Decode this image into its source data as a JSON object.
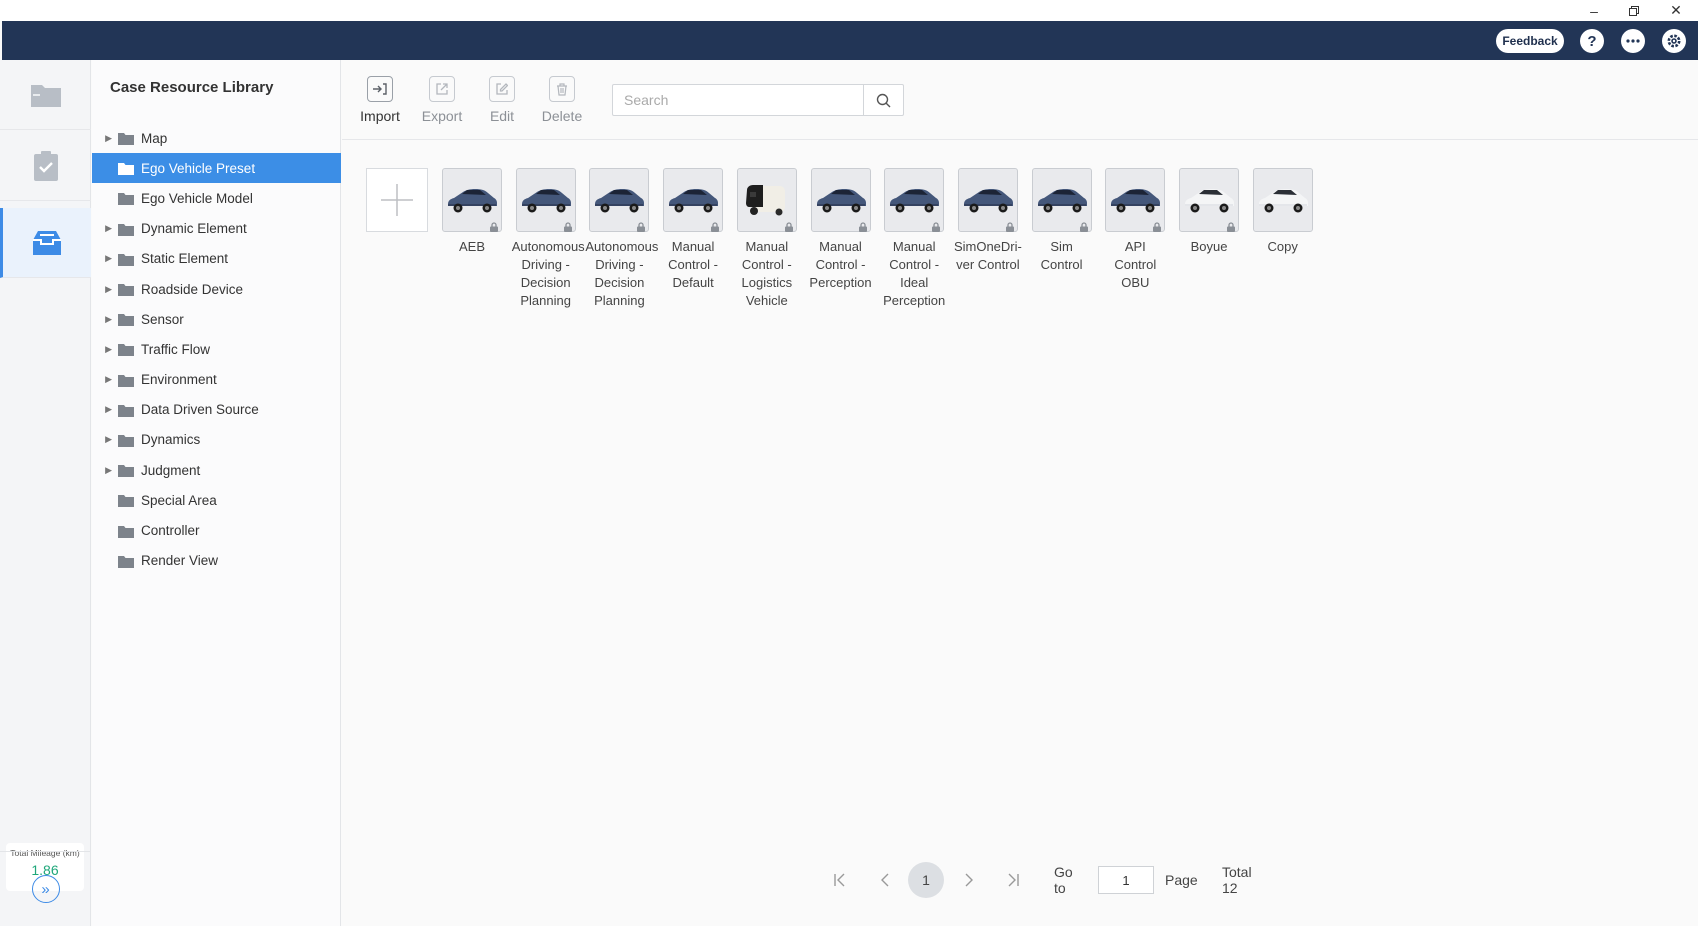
{
  "window": {
    "minimize_icon": "minimize-icon",
    "restore_icon": "restore-icon",
    "close_icon": "close-icon"
  },
  "header": {
    "feedback_label": "Feedback",
    "help_icon": "help-icon",
    "more_icon": "more-icon",
    "settings_icon": "settings-icon",
    "background_color": "#223556"
  },
  "rail": {
    "items": [
      {
        "icon": "folder-icon"
      },
      {
        "icon": "clipboard-check-icon"
      },
      {
        "icon": "tray-icon",
        "active": true
      }
    ],
    "mileage_label": "Total Mileage (km)",
    "mileage_value": "1.86",
    "expand_icon": "double-chevron-right-icon"
  },
  "tree": {
    "title": "Case Resource Library",
    "items": [
      {
        "label": "Map",
        "expandable": true
      },
      {
        "label": "Ego Vehicle Preset",
        "expandable": false,
        "selected": true
      },
      {
        "label": "Ego Vehicle Model",
        "expandable": false
      },
      {
        "label": "Dynamic Element",
        "expandable": true
      },
      {
        "label": "Static Element",
        "expandable": true
      },
      {
        "label": "Roadside Device",
        "expandable": true
      },
      {
        "label": "Sensor",
        "expandable": true
      },
      {
        "label": "Traffic Flow",
        "expandable": true
      },
      {
        "label": "Environment",
        "expandable": true
      },
      {
        "label": "Data Driven Source",
        "expandable": true
      },
      {
        "label": "Dynamics",
        "expandable": true
      },
      {
        "label": "Judgment",
        "expandable": true
      },
      {
        "label": "Special Area",
        "expandable": false
      },
      {
        "label": "Controller",
        "expandable": false
      },
      {
        "label": "Render View",
        "expandable": false
      }
    ],
    "accent_color": "#3c8ee6"
  },
  "toolbar": {
    "import_label": "Import",
    "export_label": "Export",
    "edit_label": "Edit",
    "delete_label": "Delete",
    "search_placeholder": "Search"
  },
  "cards": [
    {
      "lines": [
        "AEB"
      ],
      "thumb": "sedan-blue",
      "locked": true
    },
    {
      "lines": [
        "Autonomous",
        "Driving -",
        "Decision",
        "Planning"
      ],
      "thumb": "sedan-blue",
      "locked": true
    },
    {
      "lines": [
        "Autonomous",
        "Driving -",
        "Decision",
        "Planning"
      ],
      "thumb": "sedan-blue",
      "locked": true
    },
    {
      "lines": [
        "Manual",
        "Control -",
        "Default"
      ],
      "thumb": "sedan-blue",
      "locked": true
    },
    {
      "lines": [
        "Manual",
        "Control -",
        "Logistics",
        "Vehicle"
      ],
      "thumb": "logistics-robot",
      "locked": true
    },
    {
      "lines": [
        "Manual",
        "Control -",
        "Perception"
      ],
      "thumb": "sedan-blue",
      "locked": true
    },
    {
      "lines": [
        "Manual",
        "Control -",
        "Ideal",
        "Perception"
      ],
      "thumb": "sedan-blue",
      "locked": true
    },
    {
      "lines": [
        "SimOneDri-",
        "ver Control"
      ],
      "thumb": "sedan-blue",
      "locked": true
    },
    {
      "lines": [
        "Sim",
        "Control"
      ],
      "thumb": "sedan-blue",
      "locked": true
    },
    {
      "lines": [
        "API",
        "Control",
        "OBU"
      ],
      "thumb": "sedan-blue",
      "locked": true
    },
    {
      "lines": [
        "Boyue"
      ],
      "thumb": "suv-white",
      "locked": true
    },
    {
      "lines": [
        "Copy"
      ],
      "thumb": "suv-white",
      "locked": false
    }
  ],
  "pagination": {
    "current_page": "1",
    "goto_label": "Go to",
    "goto_value": "1",
    "page_label": "Page",
    "total_label": "Total 12"
  }
}
